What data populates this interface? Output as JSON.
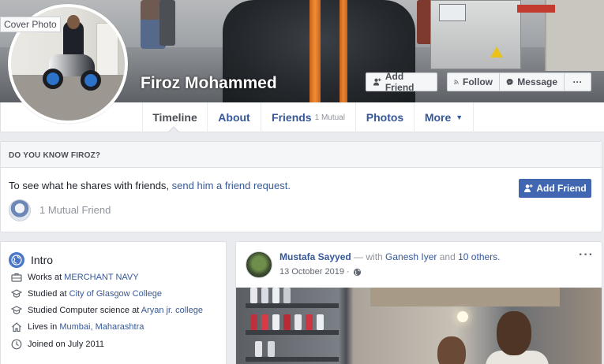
{
  "profile": {
    "cover_label": "Cover Photo",
    "name": "Firoz Mohammed",
    "buttons": {
      "add_friend": "Add Friend",
      "follow": "Follow",
      "message": "Message",
      "more": "···"
    }
  },
  "nav": {
    "tabs": [
      {
        "label": "Timeline",
        "active": true
      },
      {
        "label": "About"
      },
      {
        "label": "Friends",
        "sub": "1 Mutual"
      },
      {
        "label": "Photos"
      },
      {
        "label": "More"
      }
    ]
  },
  "know": {
    "heading": "DO YOU KNOW FIROZ?",
    "text_prefix": "To see what he shares with friends, ",
    "text_link": "send him a friend request.",
    "button": "Add Friend",
    "mutual": "1 Mutual Friend"
  },
  "intro": {
    "title": "Intro",
    "rows": [
      {
        "icon": "briefcase-icon",
        "prefix": "Works at ",
        "link": "MERCHANT NAVY"
      },
      {
        "icon": "graduation-cap-icon",
        "prefix": "Studied at ",
        "link": "City of Glasgow College"
      },
      {
        "icon": "graduation-cap-icon",
        "prefix": "Studied Computer science at ",
        "link": "Aryan jr. college"
      },
      {
        "icon": "home-icon",
        "prefix": "Lives in ",
        "link": "Mumbai, Maharashtra"
      },
      {
        "icon": "clock-icon",
        "prefix": "Joined on July 2011",
        "link": ""
      }
    ]
  },
  "post": {
    "author": "Mustafa Sayyed",
    "with_text": " — with ",
    "tagged": "Ganesh Iyer",
    "and_text": " and ",
    "others": "10 others.",
    "date": "13 October 2019 · ",
    "menu": "···"
  },
  "colors": {
    "link": "#365899",
    "primary_button": "#4267b2",
    "background": "#e9ebee"
  }
}
